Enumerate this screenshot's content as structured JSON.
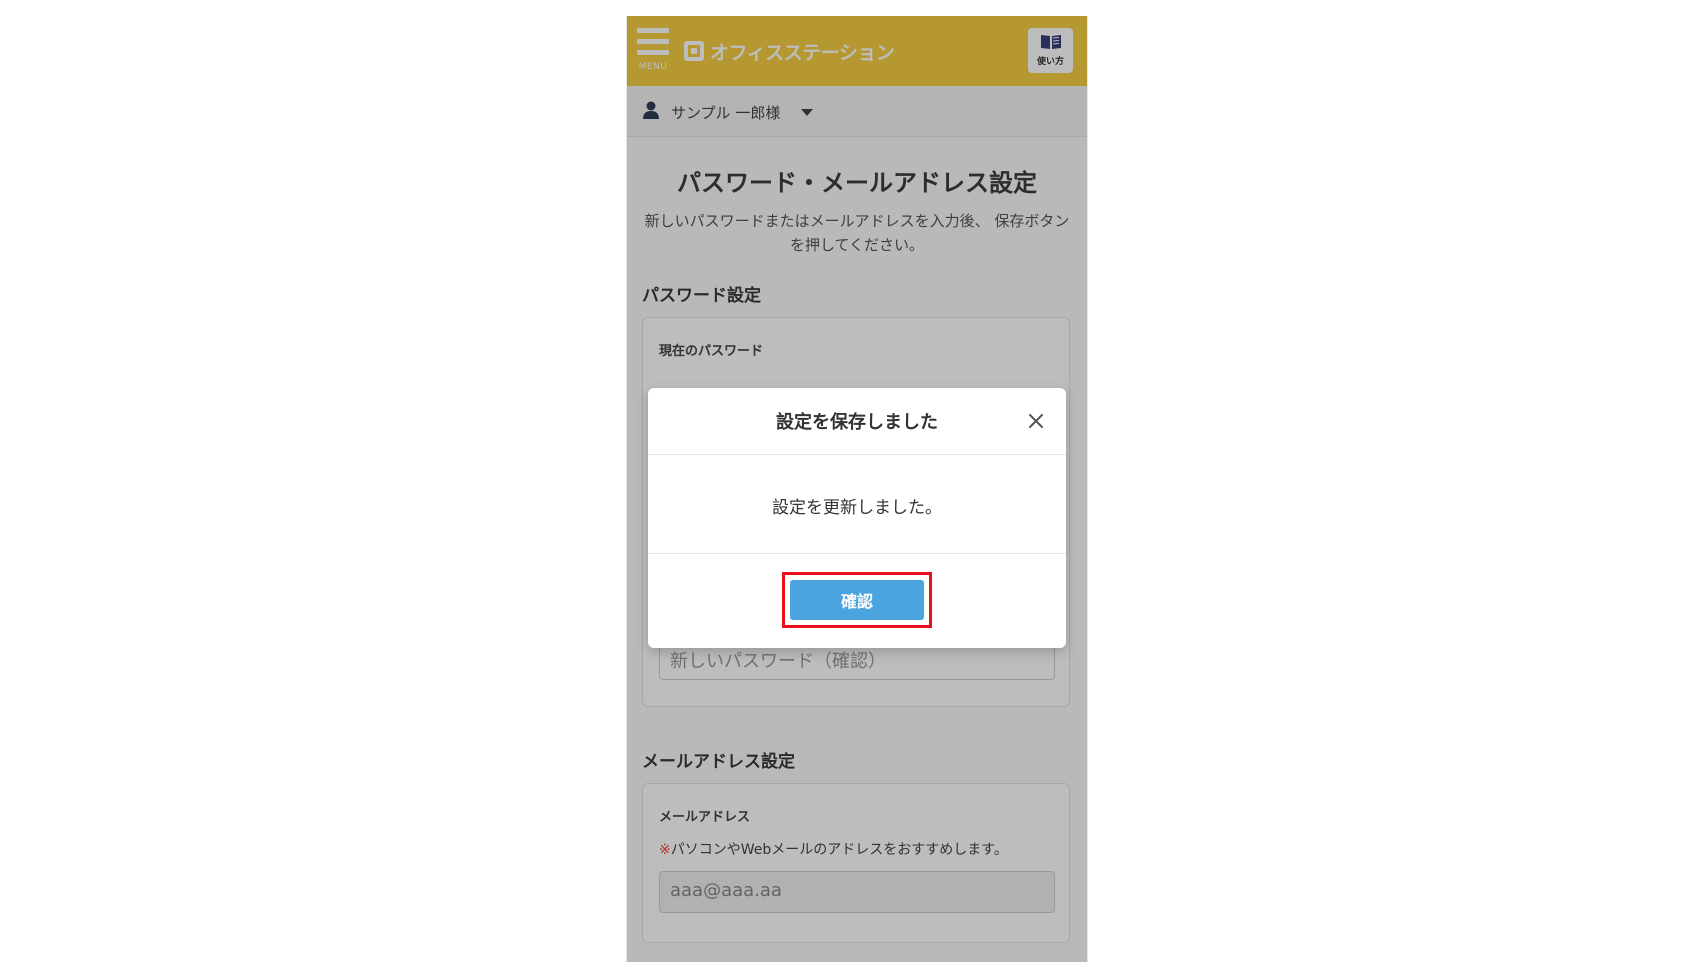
{
  "header": {
    "menu_label": "MENU",
    "brand_name": "オフィスステーション",
    "guide_label": "使い方"
  },
  "user": {
    "name": "サンプル 一郎様"
  },
  "page": {
    "title": "パスワード・メールアドレス設定",
    "description": "新しいパスワードまたはメールアドレスを入力後、 保存ボタンを押してください。"
  },
  "password_section": {
    "title": "パスワード設定",
    "current_label": "現在のパスワード",
    "confirm_placeholder": "新しいパスワード（確認）"
  },
  "email_section": {
    "title": "メールアドレス設定",
    "field_label": "メールアドレス",
    "note_mark": "※",
    "note": "パソコンやWebメールのアドレスをおすすめします。",
    "value": "aaa@aaa.aa"
  },
  "modal": {
    "title": "設定を保存しました",
    "message": "設定を更新しました。",
    "confirm_label": "確認"
  },
  "colors": {
    "header": "#f5ce43",
    "confirm": "#4ba3df",
    "highlight": "#e8101a"
  }
}
